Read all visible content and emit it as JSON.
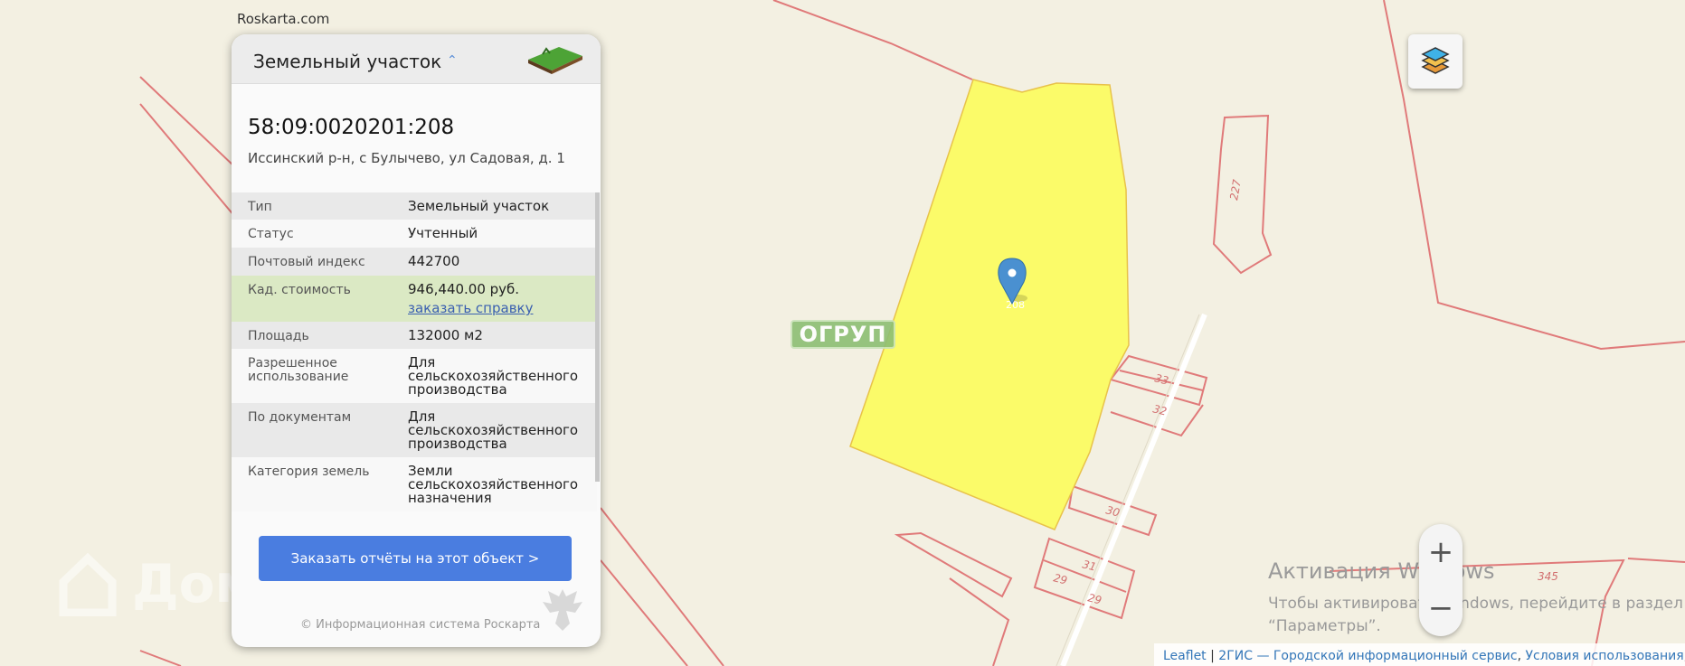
{
  "site": {
    "brand": "Roskarta.com",
    "watermark": "ДомКлик",
    "overlay_label": "ОГРУП"
  },
  "card": {
    "title": "Земельный участок",
    "cadastral_number": "58:09:0020201:208",
    "address": "Иссинский р-н, с Булычево, ул Садовая, д. 1",
    "rows": [
      {
        "key": "Тип",
        "value": "Земельный участок"
      },
      {
        "key": "Статус",
        "value": "Учтенный"
      },
      {
        "key": "Почтовый индекс",
        "value": "442700"
      },
      {
        "key": "Кад. стоимость",
        "value": "946,440.00 руб.",
        "link": "заказать справку"
      },
      {
        "key": "Площадь",
        "value": "132000 м2"
      },
      {
        "key": "Разрешенное использование",
        "value": "Для сельскохозяйственного производства"
      },
      {
        "key": "По документам",
        "value": "Для сельскохозяйственного производства"
      },
      {
        "key": "Категория земель",
        "value": "Земли сельскохозяйственного назначения"
      }
    ],
    "order_button": "Заказать отчёты на этот объект >",
    "copyright": "© Информационная система Роскарта"
  },
  "map": {
    "parcel_labels": [
      "227",
      "33",
      "32",
      "30",
      "31",
      "29",
      "29",
      "345"
    ],
    "marker_label": "208",
    "colors": {
      "background": "#f3f0e2",
      "parcel_border": "#e07a7a",
      "selected_fill": "#fbfb69",
      "marker": "#4a90d0"
    }
  },
  "zoom": {
    "in": "+",
    "out": "−"
  },
  "activation": {
    "title": "Активация Windows",
    "text": "Чтобы активировать Windows, перейдите в раздел “Параметры”."
  },
  "attribution": {
    "leaflet": "Leaflet",
    "sep": " | ",
    "provider": "2ГИС — Городской информационный сервис",
    "comma": ", ",
    "terms": "Условия использования",
    "tail": ", ©"
  }
}
